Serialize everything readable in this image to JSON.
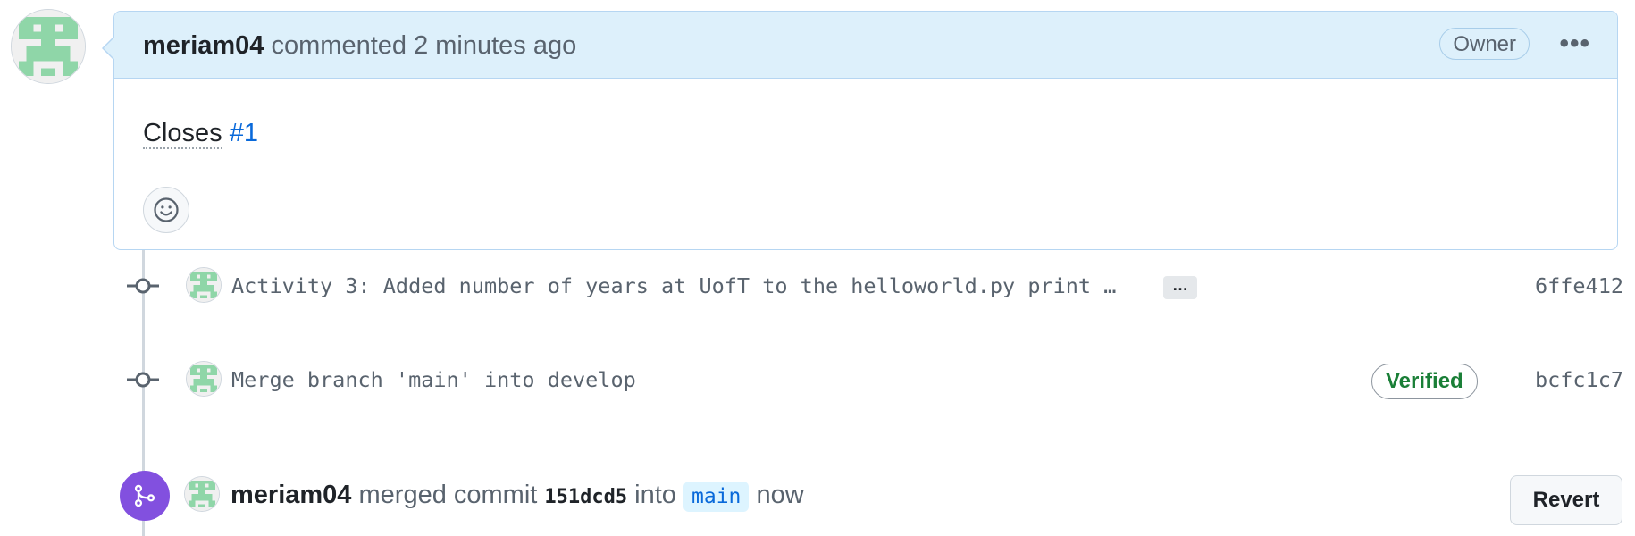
{
  "comment": {
    "author": "meriam04",
    "action": "commented",
    "timestamp": "2 minutes ago",
    "role_badge": "Owner",
    "menu_icon": "kebab-horizontal-icon",
    "body_prefix": "Closes",
    "issue_ref": "#1",
    "reaction_icon": "smiley-icon"
  },
  "commits": [
    {
      "message": "Activity 3: Added number of years at UofT to the helloworld.py print …",
      "expand_label": "…",
      "sha": "6ffe412"
    },
    {
      "message": "Merge branch 'main' into develop",
      "badge": "Verified",
      "sha": "bcfc1c7"
    }
  ],
  "merge_event": {
    "actor": "meriam04",
    "action": "merged commit",
    "commit": "151dcd5",
    "into_word": "into",
    "branch": "main",
    "time": "now",
    "revert_label": "Revert",
    "icon": "git-merge-icon"
  },
  "colors": {
    "header_bg": "#ddf0fb",
    "border": "#b6d6f2",
    "link": "#0969da",
    "merged": "#8250df",
    "verified": "#1a7f37",
    "avatar_green": "#8fd6a8"
  }
}
